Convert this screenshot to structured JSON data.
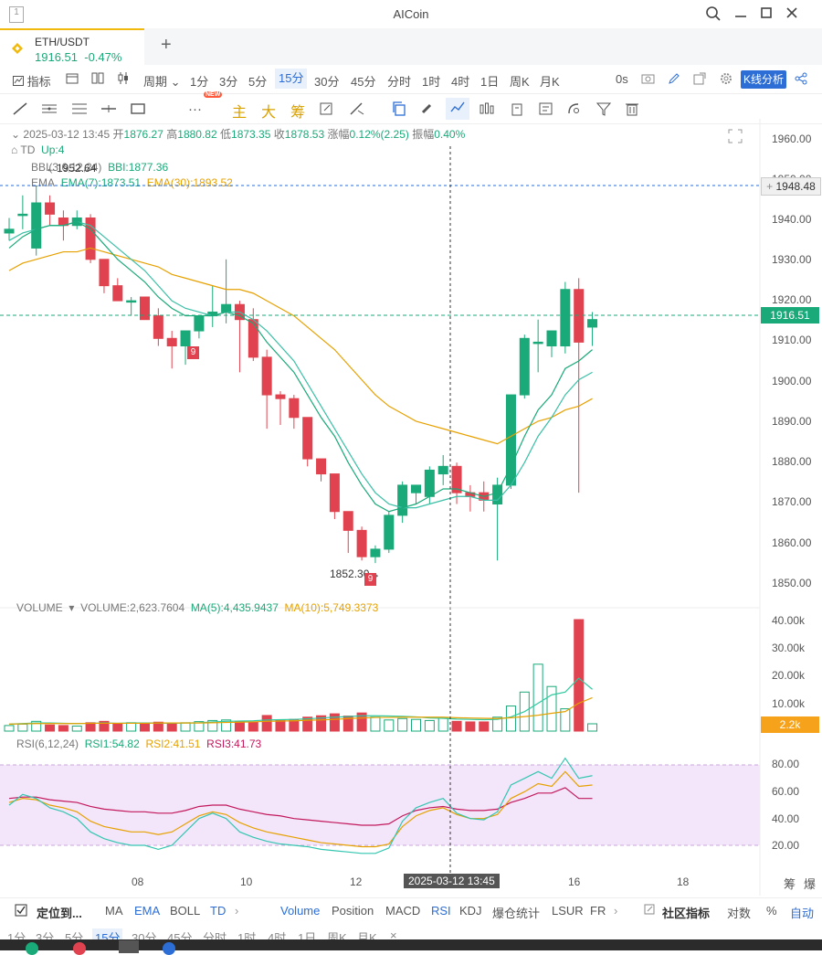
{
  "window": {
    "title": "AICoin",
    "controls": [
      "search-icon",
      "minimize-icon",
      "maximize-icon",
      "close-icon"
    ]
  },
  "tab": {
    "pair": "ETH/USDT",
    "price": "1916.51",
    "change": "-0.47%",
    "add": "+"
  },
  "toolbar1": {
    "indicator_label": "指标",
    "period_label": "周期",
    "periods": [
      "1分",
      "3分",
      "5分",
      "15分",
      "30分",
      "45分",
      "分时",
      "1时",
      "4时",
      "1日",
      "周K",
      "月K"
    ],
    "active_period": "15分",
    "countdown": "0s",
    "kline_analysis": "K线分析"
  },
  "toolbar2": {
    "main": "主",
    "big": "大",
    "chip": "筹",
    "new_badge": "NEW"
  },
  "info": {
    "datetime": "2025-03-12 13:45",
    "open_label": "开",
    "open": "1876.27",
    "high_label": "高",
    "high": "1880.82",
    "low_label": "低",
    "low": "1873.35",
    "close_label": "收",
    "close": "1878.53",
    "change_label": "涨幅",
    "change": "0.12%(2.25)",
    "amp_label": "振幅",
    "amp": "0.40%"
  },
  "td_line": {
    "name": "TD",
    "value": "Up:4"
  },
  "bbi_line": {
    "name": "BBI(3,6,12,24)",
    "value": "BBI:1877.36"
  },
  "ema_line": {
    "name": "EMA",
    "ema7": "EMA(7):1873.51",
    "ema30": "EMA(30):1893.52"
  },
  "high_mark": "1952.64",
  "low_mark": "1852.30",
  "td_marks": [
    "9",
    "9"
  ],
  "price_axis": [
    "1960.00",
    "1950.00",
    "1940.00",
    "1930.00",
    "1920.00",
    "1910.00",
    "1900.00",
    "1890.00",
    "1880.00",
    "1870.00",
    "1860.00",
    "1850.00"
  ],
  "crosshair_price": "1948.48",
  "last_price": "1916.51",
  "volume": {
    "label": "VOLUME",
    "value": "VOLUME:2,623.7604",
    "ma5": "MA(5):4,435.9437",
    "ma10": "MA(10):5,749.3373",
    "axis": [
      "40.00k",
      "30.00k",
      "20.00k",
      "10.00k"
    ],
    "last": "2.2k"
  },
  "rsi": {
    "label": "RSI(6,12,24)",
    "rsi1": "RSI1:54.82",
    "rsi2": "RSI2:41.51",
    "rsi3": "RSI3:41.73",
    "axis": [
      "80.00",
      "60.00",
      "40.00",
      "20.00"
    ]
  },
  "time_axis": {
    "labels": [
      "08",
      "10",
      "12",
      "16",
      "18"
    ],
    "crosshair": "2025-03-12 13:45",
    "right": [
      "筹",
      "爆"
    ]
  },
  "bottombar": {
    "locate": "定位到...",
    "items": [
      "MA",
      "EMA",
      "BOLL",
      "TD"
    ],
    "sub_items": [
      "Volume",
      "Position",
      "MACD",
      "RSI",
      "KDJ",
      "爆仓统计",
      "LSUR",
      "FR"
    ],
    "community": "社区指标",
    "log": "对数",
    "pct": "%",
    "auto": "自动"
  },
  "periodbar": [
    "1分",
    "3分",
    "5分",
    "15分",
    "30分",
    "45分",
    "分时",
    "1时",
    "4时",
    "1日",
    "周K",
    "月K"
  ],
  "colors": {
    "up": "#1aa979",
    "down": "#e0434f",
    "accent": "#2c6ed5",
    "ema30": "#e6a100",
    "rsi_band": "#f3e6fb"
  },
  "chart_data": {
    "type": "candlestick",
    "ylim": [
      1847,
      1965
    ],
    "candles": [
      {
        "o": 1940,
        "h": 1944,
        "l": 1938,
        "c": 1941
      },
      {
        "o": 1945,
        "h": 1950,
        "l": 1941,
        "c": 1945
      },
      {
        "o": 1936,
        "h": 1952.6,
        "l": 1934,
        "c": 1948
      },
      {
        "o": 1948,
        "h": 1950,
        "l": 1942,
        "c": 1945
      },
      {
        "o": 1944,
        "h": 1946,
        "l": 1938,
        "c": 1942
      },
      {
        "o": 1942,
        "h": 1946,
        "l": 1941,
        "c": 1944
      },
      {
        "o": 1944,
        "h": 1945,
        "l": 1932,
        "c": 1933
      },
      {
        "o": 1933,
        "h": 1933,
        "l": 1924,
        "c": 1926
      },
      {
        "o": 1926,
        "h": 1928,
        "l": 1922,
        "c": 1922
      },
      {
        "o": 1922,
        "h": 1923,
        "l": 1918,
        "c": 1922
      },
      {
        "o": 1923,
        "h": 1923,
        "l": 1917,
        "c": 1917
      },
      {
        "o": 1918,
        "h": 1920,
        "l": 1910,
        "c": 1912
      },
      {
        "o": 1912,
        "h": 1914,
        "l": 1904,
        "c": 1910
      },
      {
        "o": 1910,
        "h": 1914,
        "l": 1905,
        "c": 1914
      },
      {
        "o": 1914,
        "h": 1918,
        "l": 1912,
        "c": 1918
      },
      {
        "o": 1918,
        "h": 1926,
        "l": 1915,
        "c": 1919
      },
      {
        "o": 1919,
        "h": 1933,
        "l": 1916,
        "c": 1921
      },
      {
        "o": 1921,
        "h": 1922,
        "l": 1903,
        "c": 1917
      },
      {
        "o": 1917,
        "h": 1920,
        "l": 1906,
        "c": 1907
      },
      {
        "o": 1907,
        "h": 1909,
        "l": 1888,
        "c": 1897
      },
      {
        "o": 1897,
        "h": 1898,
        "l": 1889,
        "c": 1896
      },
      {
        "o": 1896,
        "h": 1897,
        "l": 1888,
        "c": 1891
      },
      {
        "o": 1891,
        "h": 1891,
        "l": 1878,
        "c": 1880
      },
      {
        "o": 1880,
        "h": 1880,
        "l": 1874,
        "c": 1876
      },
      {
        "o": 1876,
        "h": 1876,
        "l": 1864,
        "c": 1866
      },
      {
        "o": 1866,
        "h": 1866,
        "l": 1855,
        "c": 1861
      },
      {
        "o": 1861,
        "h": 1862,
        "l": 1853,
        "c": 1854
      },
      {
        "o": 1854,
        "h": 1857,
        "l": 1852.3,
        "c": 1856
      },
      {
        "o": 1856,
        "h": 1866,
        "l": 1855,
        "c": 1865
      },
      {
        "o": 1865,
        "h": 1874,
        "l": 1863,
        "c": 1873
      },
      {
        "o": 1871,
        "h": 1873,
        "l": 1868,
        "c": 1873
      },
      {
        "o": 1870,
        "h": 1878,
        "l": 1868,
        "c": 1877
      },
      {
        "o": 1876,
        "h": 1881,
        "l": 1873,
        "c": 1878
      },
      {
        "o": 1878,
        "h": 1879,
        "l": 1868,
        "c": 1871
      },
      {
        "o": 1871,
        "h": 1873,
        "l": 1866,
        "c": 1870
      },
      {
        "o": 1871,
        "h": 1874,
        "l": 1866,
        "c": 1869
      },
      {
        "o": 1868,
        "h": 1875,
        "l": 1853,
        "c": 1873
      },
      {
        "o": 1873,
        "h": 1881,
        "l": 1872,
        "c": 1897
      },
      {
        "o": 1897,
        "h": 1913,
        "l": 1896,
        "c": 1912
      },
      {
        "o": 1911,
        "h": 1917,
        "l": 1903,
        "c": 1911
      },
      {
        "o": 1910,
        "h": 1914,
        "l": 1907,
        "c": 1914
      },
      {
        "o": 1910,
        "h": 1927,
        "l": 1908,
        "c": 1925
      },
      {
        "o": 1925,
        "h": 1928,
        "l": 1871,
        "c": 1911
      },
      {
        "o": 1915,
        "h": 1919,
        "l": 1910,
        "c": 1917
      }
    ],
    "volume_values": [
      2000,
      2500,
      3500,
      2200,
      2000,
      1800,
      3000,
      3500,
      2500,
      3000,
      2800,
      3200,
      2600,
      3000,
      3400,
      3800,
      4000,
      3500,
      3200,
      5600,
      4000,
      4200,
      5000,
      5500,
      6200,
      5400,
      6500,
      5000,
      4000,
      4500,
      4200,
      3800,
      4600,
      3500,
      3300,
      3300,
      5000,
      9000,
      14000,
      24000,
      16000,
      8000,
      40000,
      2624
    ],
    "ema7": [
      1936,
      1939,
      1941,
      1942,
      1942,
      1943,
      1941,
      1937,
      1933,
      1930,
      1927,
      1923,
      1920,
      1918,
      1918,
      1918,
      1919,
      1918,
      1916,
      1911,
      1907,
      1903,
      1897,
      1891,
      1886,
      1879,
      1873,
      1868,
      1866,
      1867,
      1868,
      1870,
      1872,
      1872,
      1871,
      1870,
      1871,
      1878,
      1886,
      1893,
      1897,
      1904,
      1906,
      1909
    ],
    "bbi": [
      1938,
      1940,
      1941,
      1942,
      1942,
      1943,
      1942,
      1939,
      1936,
      1933,
      1930,
      1926,
      1922,
      1920,
      1919,
      1918,
      1919,
      1919,
      1917,
      1914,
      1910,
      1906,
      1900,
      1894,
      1888,
      1882,
      1876,
      1871,
      1868,
      1867,
      1867,
      1868,
      1869,
      1870,
      1870,
      1869,
      1869,
      1873,
      1879,
      1886,
      1891,
      1897,
      1901,
      1903
    ],
    "ema30": [
      1930,
      1932,
      1933,
      1934,
      1935,
      1935,
      1936,
      1935,
      1934,
      1933,
      1932,
      1931,
      1929,
      1928,
      1927,
      1926,
      1925,
      1925,
      1924,
      1922,
      1920,
      1918,
      1915,
      1912,
      1909,
      1905,
      1901,
      1897,
      1894,
      1892,
      1890,
      1889,
      1888,
      1887,
      1886,
      1885,
      1884,
      1886,
      1888,
      1890,
      1891,
      1893,
      1894,
      1896
    ],
    "vol_ma5": [
      2500,
      2700,
      2900,
      2900,
      2800,
      2700,
      2800,
      2900,
      2800,
      2900,
      2900,
      2900,
      2800,
      2900,
      3000,
      3300,
      3500,
      3600,
      3700,
      4000,
      4100,
      4200,
      4400,
      4700,
      5000,
      5200,
      5500,
      5500,
      5400,
      5300,
      5100,
      4700,
      4600,
      4300,
      4200,
      4100,
      4200,
      5100,
      7000,
      10000,
      13000,
      14000,
      19000,
      15000
    ],
    "vol_ma10": [
      2500,
      2600,
      2700,
      2700,
      2700,
      2700,
      2800,
      2800,
      2800,
      2800,
      2800,
      2900,
      2900,
      2900,
      2900,
      3000,
      3100,
      3200,
      3300,
      3500,
      3600,
      3700,
      3900,
      4000,
      4200,
      4500,
      4700,
      4900,
      4900,
      5000,
      5000,
      5000,
      5000,
      4800,
      4700,
      4600,
      4500,
      4800,
      5200,
      5700,
      6400,
      7000,
      10000,
      12000
    ],
    "rsi1": [
      50,
      58,
      55,
      48,
      45,
      40,
      30,
      25,
      22,
      20,
      20,
      17,
      20,
      30,
      40,
      44,
      40,
      30,
      26,
      23,
      21,
      20,
      19,
      17,
      16,
      15,
      14,
      14,
      18,
      38,
      48,
      52,
      55,
      44,
      40,
      39,
      45,
      65,
      70,
      75,
      70,
      85,
      70,
      72
    ],
    "rsi2": [
      52,
      55,
      54,
      50,
      48,
      45,
      38,
      34,
      32,
      30,
      30,
      28,
      30,
      36,
      42,
      45,
      43,
      37,
      33,
      30,
      28,
      26,
      24,
      22,
      21,
      20,
      19,
      19,
      21,
      34,
      42,
      46,
      48,
      43,
      40,
      40,
      43,
      55,
      60,
      66,
      64,
      75,
      64,
      65
    ],
    "rsi3": [
      55,
      56,
      56,
      54,
      53,
      52,
      49,
      47,
      46,
      45,
      45,
      44,
      44,
      46,
      49,
      50,
      50,
      47,
      45,
      43,
      42,
      40,
      39,
      38,
      37,
      36,
      35,
      35,
      36,
      42,
      46,
      48,
      49,
      47,
      46,
      46,
      47,
      52,
      55,
      59,
      59,
      63,
      55,
      55
    ]
  }
}
